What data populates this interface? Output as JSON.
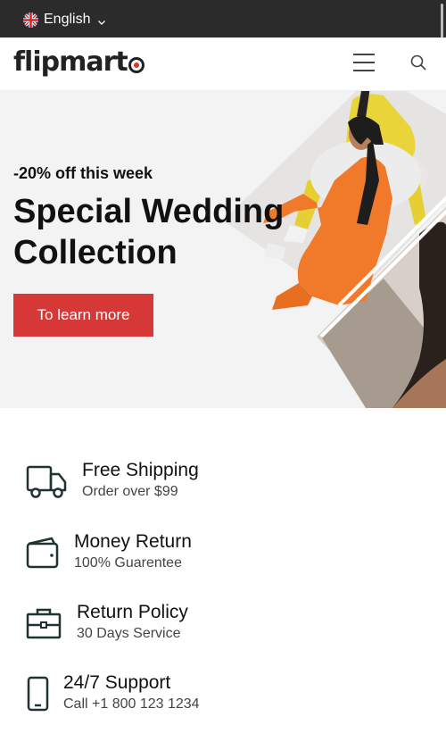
{
  "topbar": {
    "language": "English",
    "flag_icon": "uk-flag-icon",
    "dropdown_icon": "chevron-down-icon"
  },
  "header": {
    "logo_text_a": "flipmart",
    "logo_text_b": "o",
    "menu_icon": "hamburger-menu-icon",
    "search_icon": "search-icon",
    "accent_color": "#d63838"
  },
  "hero": {
    "eyebrow": "-20% off this week",
    "title": "Special Wedding Collection",
    "cta_label": "To learn more"
  },
  "features": [
    {
      "icon": "truck-icon",
      "title": "Free Shipping",
      "subtitle": "Order over $99"
    },
    {
      "icon": "wallet-icon",
      "title": "Money Return",
      "subtitle": "100% Guarentee"
    },
    {
      "icon": "briefcase-icon",
      "title": "Return Policy",
      "subtitle": "30 Days Service"
    },
    {
      "icon": "phone-icon",
      "title": "24/7 Support",
      "subtitle": "Call +1 800 123 1234"
    }
  ]
}
